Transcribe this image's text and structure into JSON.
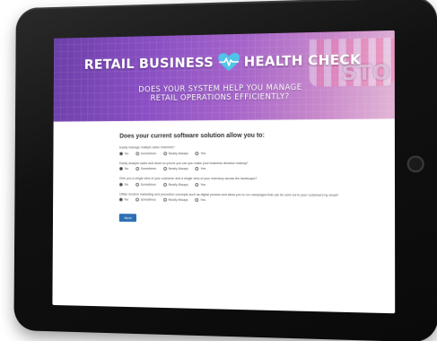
{
  "banner": {
    "title_left": "RETAIL BUSINESS",
    "title_right": "HEALTH CHECK",
    "subtitle_line1": "DOES YOUR SYSTEM HELP YOU MANAGE",
    "subtitle_line2": "RETAIL OPERATIONS EFFICIENTLY?",
    "store_sign": "STO"
  },
  "form": {
    "heading": "Does your current software solution allow you to:",
    "questions": [
      {
        "text": "Easily manage multiple sales channels?",
        "options": [
          "No",
          "Sometimes",
          "Nearly Always",
          "Yes"
        ],
        "selected": "No"
      },
      {
        "text": "Easily analyse sales and stock so you/or you can you make your business decision making?",
        "options": [
          "No",
          "Sometimes",
          "Nearly Always",
          "Yes"
        ],
        "selected": "No"
      },
      {
        "text": "Give you a single view of your customer and a single view of your inventory across the landscape?",
        "options": [
          "No",
          "Sometimes",
          "Nearly Always",
          "Yes"
        ],
        "selected": "No"
      },
      {
        "text": "Utilise modern marketing and promotion concepts such as digital promos and allow you to run campaigns that can be sent out to your customers by email?",
        "options": [
          "No",
          "Sometimes",
          "Nearly Always",
          "Yes"
        ],
        "selected": "No"
      }
    ],
    "next_label": "Next"
  },
  "colors": {
    "banner_start": "#6b3fa8",
    "banner_end": "#e2b6d6",
    "heart": "#4fc3e8",
    "button": "#2f6fb3"
  }
}
